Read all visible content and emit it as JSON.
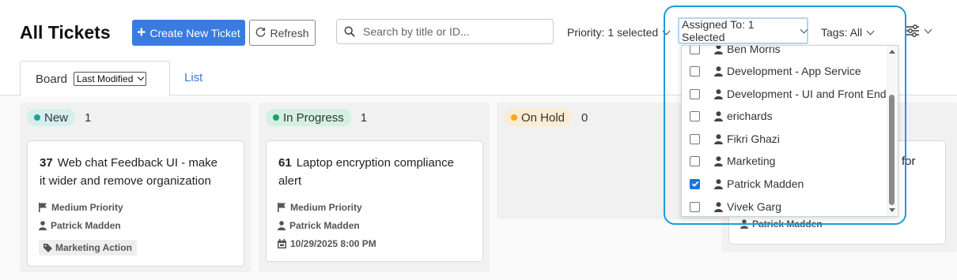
{
  "page": {
    "title": "All Tickets"
  },
  "toolbar": {
    "create_label": "Create New Ticket",
    "refresh_label": "Refresh",
    "search_placeholder": "Search by title or ID..."
  },
  "filters": {
    "priority": "Priority: 1 selected",
    "assigned": "Assigned To: 1 Selected",
    "tags": "Tags: All"
  },
  "tabs": {
    "board": "Board",
    "sort_selected": "Last Modified",
    "list": "List"
  },
  "columns": [
    {
      "name": "New",
      "count": "1",
      "dot_color": "#1aa39a",
      "pill_color": "#d5efee"
    },
    {
      "name": "In Progress",
      "count": "1",
      "dot_color": "#1aa371",
      "pill_color": "#d3f0e3"
    },
    {
      "name": "On Hold",
      "count": "0",
      "dot_color": "#f5a623",
      "pill_color": "#fbecd3"
    }
  ],
  "cards": [
    {
      "id": "37",
      "title_line1": "Web chat Feedback UI - make",
      "title_line2": "it wider and remove organization",
      "priority": "Medium Priority",
      "assignee": "Patrick Madden",
      "tag": "Marketing Action"
    },
    {
      "id": "61",
      "title_line1": "Laptop encryption compliance",
      "title_line2": "alert",
      "priority": "Medium Priority",
      "assignee": "Patrick Madden",
      "due": "10/29/2025 8:00 PM"
    },
    {
      "partial_title": "for",
      "assignee": "Patrick Madden"
    }
  ],
  "assignee_options": [
    {
      "label": "Ben Morris",
      "checked": false
    },
    {
      "label": "Development - App Service",
      "checked": false
    },
    {
      "label": "Development - UI and Front End",
      "checked": false
    },
    {
      "label": "erichards",
      "checked": false
    },
    {
      "label": "Fikri Ghazi",
      "checked": false
    },
    {
      "label": "Marketing",
      "checked": false
    },
    {
      "label": "Patrick Madden",
      "checked": true
    },
    {
      "label": "Vivek Garg",
      "checked": false
    }
  ],
  "colors": {
    "primary": "#3a7be0",
    "highlight_ring": "#1a9cd8",
    "checkbox_checked": "#1a73e8"
  }
}
